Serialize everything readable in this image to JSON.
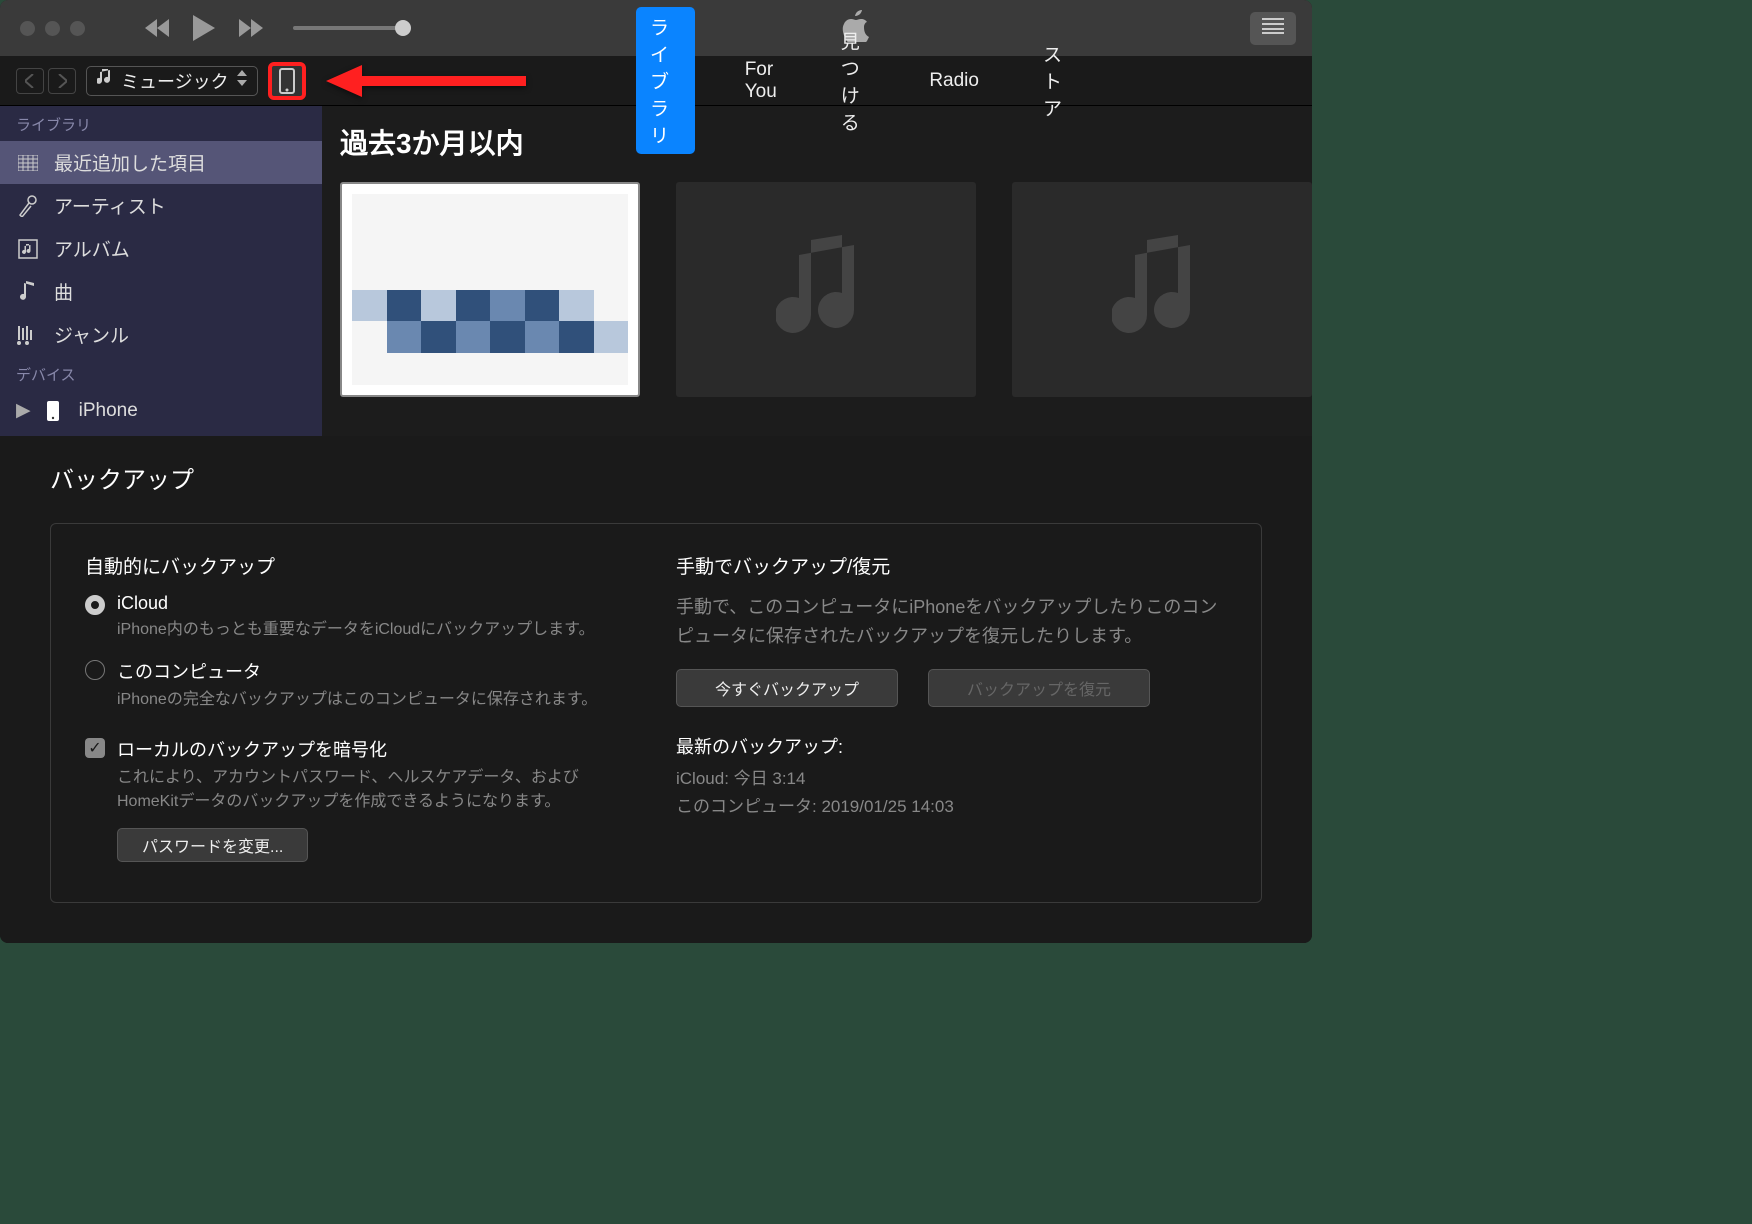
{
  "toolbar": {
    "media_selector": "ミュージック",
    "tabs": [
      "ライブラリ",
      "For You",
      "見つける",
      "Radio",
      "ストア"
    ],
    "active_tab_index": 0
  },
  "sidebar": {
    "library_header": "ライブラリ",
    "items": [
      {
        "label": "最近追加した項目"
      },
      {
        "label": "アーティスト"
      },
      {
        "label": "アルバム"
      },
      {
        "label": "曲"
      },
      {
        "label": "ジャンル"
      }
    ],
    "device_header": "デバイス",
    "device_label": "iPhone"
  },
  "main": {
    "heading": "過去3か月以内"
  },
  "backup": {
    "section_title": "バックアップ",
    "auto": {
      "title": "自動的にバックアップ",
      "icloud_label": "iCloud",
      "icloud_desc": "iPhone内のもっとも重要なデータをiCloudにバックアップします。",
      "computer_label": "このコンピュータ",
      "computer_desc": "iPhoneの完全なバックアップはこのコンピュータに保存されます。",
      "encrypt_label": "ローカルのバックアップを暗号化",
      "encrypt_desc": "これにより、アカウントパスワード、ヘルスケアデータ、およびHomeKitデータのバックアップを作成できるようになります。",
      "change_password_btn": "パスワードを変更..."
    },
    "manual": {
      "title": "手動でバックアップ/復元",
      "desc": "手動で、このコンピュータにiPhoneをバックアップしたりこのコンピュータに保存されたバックアップを復元したりします。",
      "backup_now_btn": "今すぐバックアップ",
      "restore_btn": "バックアップを復元"
    },
    "latest": {
      "title": "最新のバックアップ:",
      "icloud_line": "iCloud: 今日 3:14",
      "computer_line": "このコンピュータ: 2019/01/25 14:03"
    }
  }
}
